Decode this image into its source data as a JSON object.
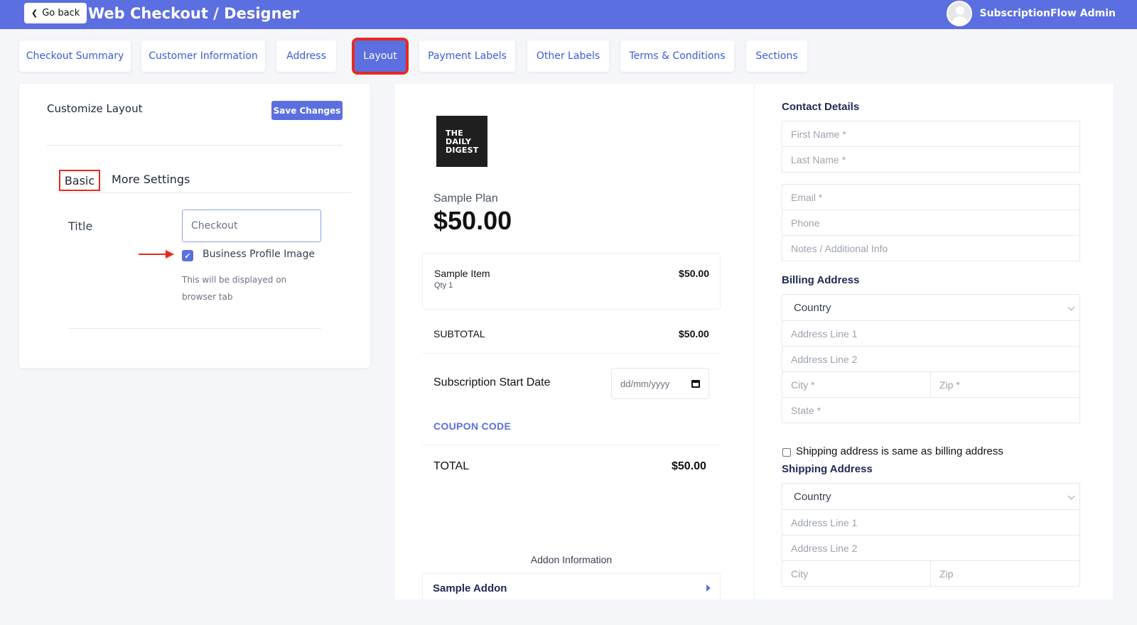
{
  "header": {
    "back_label": "Go back",
    "title": "Web Checkout / Designer",
    "user_name": "SubscriptionFlow Admin"
  },
  "tabs": [
    {
      "label": "Checkout Summary",
      "active": false
    },
    {
      "label": "Customer Information",
      "active": false
    },
    {
      "label": "Address",
      "active": false
    },
    {
      "label": "Layout",
      "active": true
    },
    {
      "label": "Payment Labels",
      "active": false
    },
    {
      "label": "Other Labels",
      "active": false
    },
    {
      "label": "Terms & Conditions",
      "active": false
    },
    {
      "label": "Sections",
      "active": false
    }
  ],
  "customize": {
    "title": "Customize Layout",
    "save_label": "Save Changes",
    "subtabs": {
      "basic": "Basic",
      "more": "More Settings"
    },
    "title_field_label": "Title",
    "title_field_value": "Checkout",
    "business_image_label": "Business Profile Image",
    "business_image_checked": true,
    "business_image_help": "This will be displayed on browser tab"
  },
  "preview": {
    "logo_text": [
      "THE",
      "DAILY",
      "DIGEST"
    ],
    "plan_name": "Sample Plan",
    "plan_price": "$50.00",
    "item": {
      "name": "Sample Item",
      "qty": "Qty   1",
      "price": "$50.00"
    },
    "subtotal_label": "SUBTOTAL",
    "subtotal_value": "$50.00",
    "start_date_label": "Subscription Start Date",
    "start_date_placeholder": "dd/mm/yyyy",
    "coupon_label": "COUPON CODE",
    "total_label": "TOTAL",
    "total_value": "$50.00",
    "addon_info": "Addon Information",
    "addon_name": "Sample Addon"
  },
  "form": {
    "contact_title": "Contact Details",
    "first_name": "First Name *",
    "last_name": "Last Name *",
    "email": "Email *",
    "phone": "Phone",
    "notes": "Notes / Additional Info",
    "billing_title": "Billing Address",
    "billing": {
      "country": "Country",
      "line1": "Address Line 1",
      "line2": "Address Line 2",
      "city": "City *",
      "zip": "Zip *",
      "state": "State *"
    },
    "same_as_billing_label": "Shipping address is same as billing address",
    "same_as_billing_checked": false,
    "shipping_title": "Shipping Address",
    "shipping": {
      "country": "Country",
      "line1": "Address Line 1",
      "line2": "Address Line 2",
      "city": "City",
      "zip": "Zip"
    }
  },
  "colors": {
    "accent": "#5b6fe0",
    "highlight": "#e8281e"
  }
}
